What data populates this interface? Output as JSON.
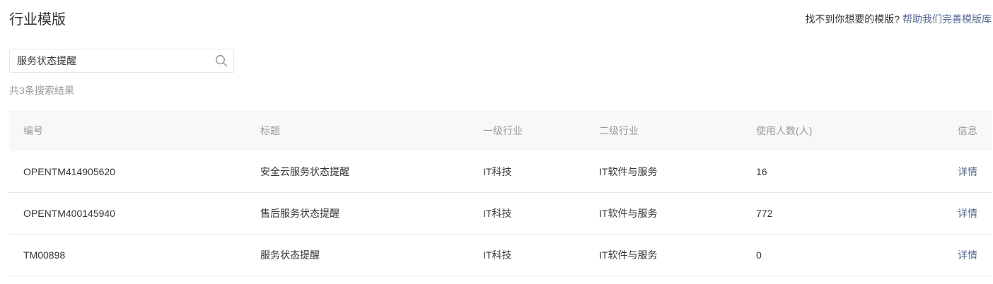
{
  "header": {
    "title": "行业模版",
    "help_text": "找不到你想要的模版?",
    "help_link": "帮助我们完善模版库"
  },
  "search": {
    "value": "服务状态提醒",
    "icon": "search-icon"
  },
  "result_count": "共3条搜索结果",
  "table": {
    "columns": [
      "编号",
      "标题",
      "一级行业",
      "二级行业",
      "使用人数(人)",
      "信息"
    ],
    "rows": [
      {
        "id": "OPENTM414905620",
        "title": "安全云服务状态提醒",
        "industry1": "IT科技",
        "industry2": "IT软件与服务",
        "users": "16",
        "action": "详情"
      },
      {
        "id": "OPENTM400145940",
        "title": "售后服务状态提醒",
        "industry1": "IT科技",
        "industry2": "IT软件与服务",
        "users": "772",
        "action": "详情"
      },
      {
        "id": "TM00898",
        "title": "服务状态提醒",
        "industry1": "IT科技",
        "industry2": "IT软件与服务",
        "users": "0",
        "action": "详情"
      }
    ]
  },
  "colors": {
    "link": "#576b95",
    "muted": "#9a9a9a",
    "header_bg": "#f6f8f9",
    "divider": "#e7e7eb"
  }
}
